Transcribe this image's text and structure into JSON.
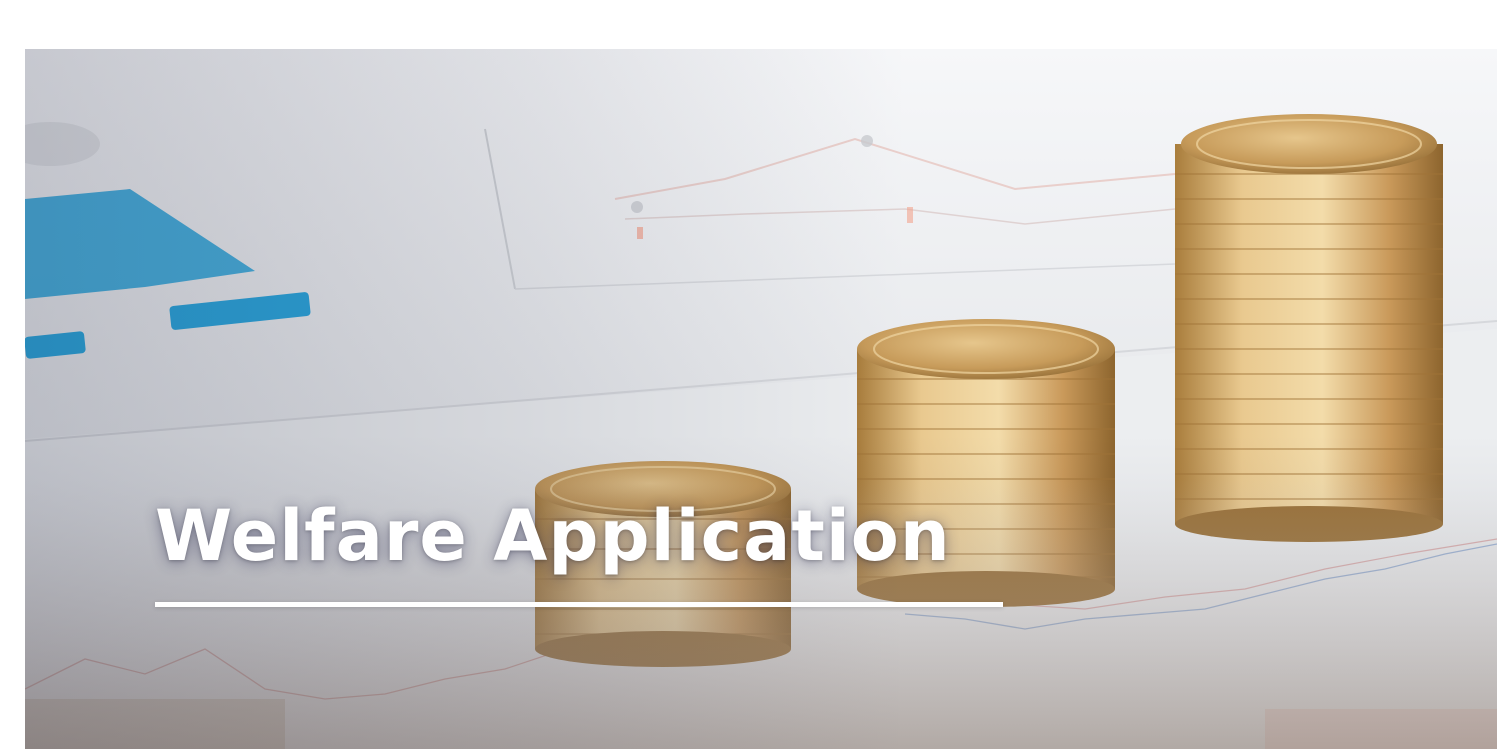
{
  "banner": {
    "title": "Welfare Application",
    "image_subject": "stacks-of-gold-coins-on-financial-charts"
  },
  "colors": {
    "title_text": "#ffffff",
    "underline": "#ffffff",
    "coin_gold": "#d8b072",
    "chart_blue": "#29a9e0"
  }
}
